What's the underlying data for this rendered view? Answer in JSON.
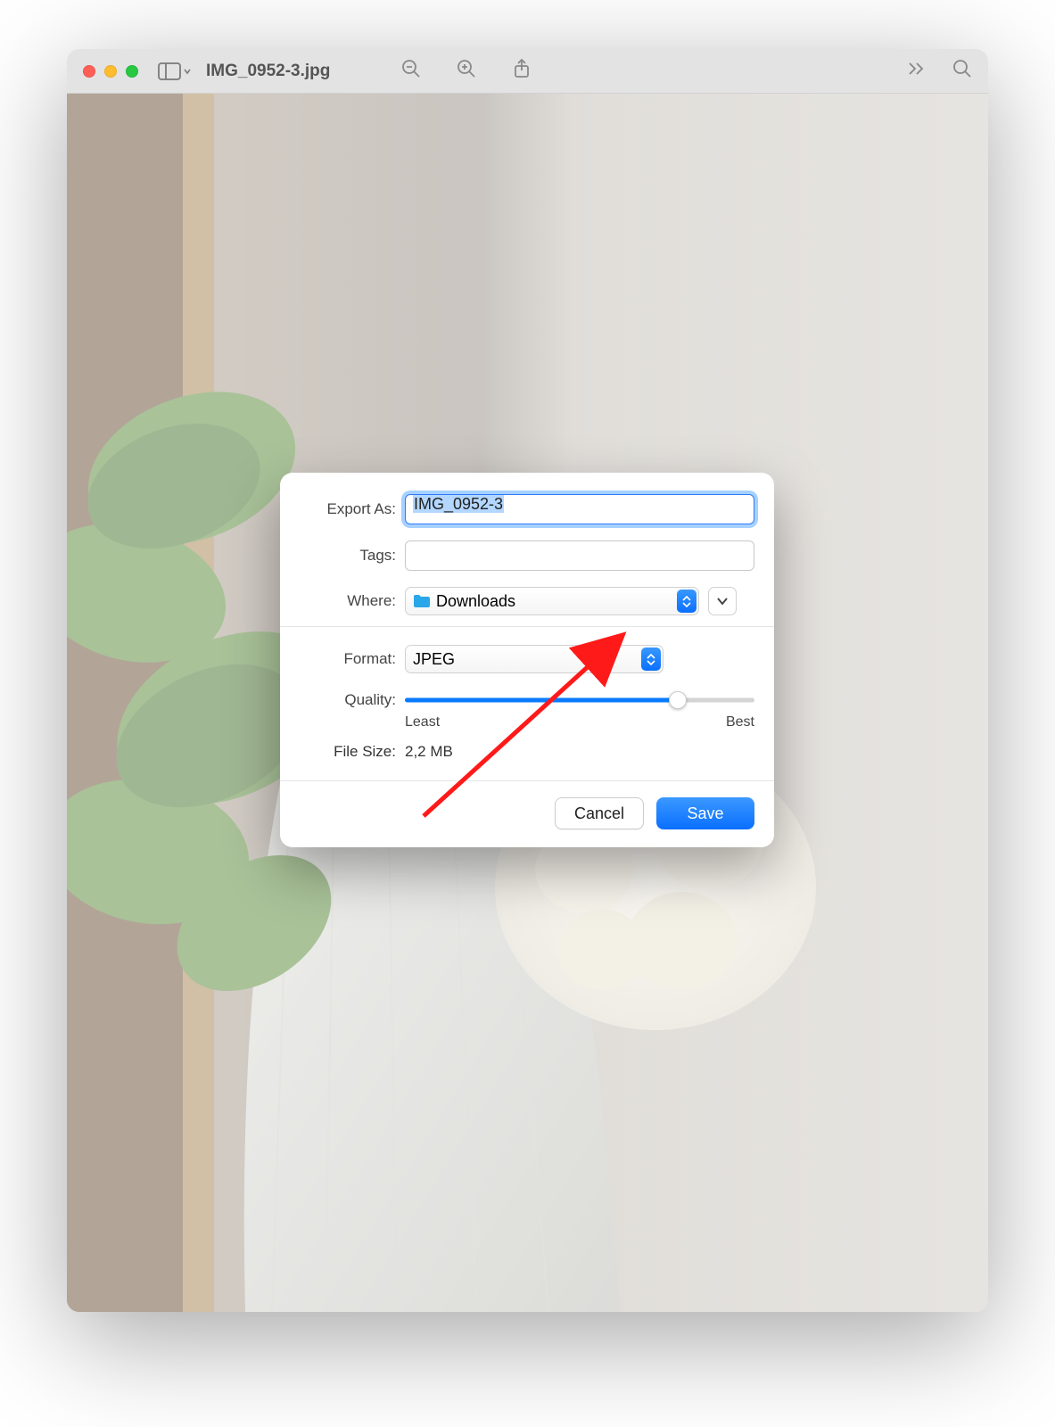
{
  "window": {
    "title": "IMG_0952-3.jpg"
  },
  "export": {
    "export_as_label": "Export As:",
    "filename": "IMG_0952-3",
    "tags_label": "Tags:",
    "tags_value": "",
    "where_label": "Where:",
    "where_value": "Downloads",
    "format_label": "Format:",
    "format_value": "JPEG",
    "quality_label": "Quality:",
    "quality_least": "Least",
    "quality_best": "Best",
    "filesize_label": "File Size:",
    "filesize_value": "2,2 MB",
    "cancel": "Cancel",
    "save": "Save"
  }
}
